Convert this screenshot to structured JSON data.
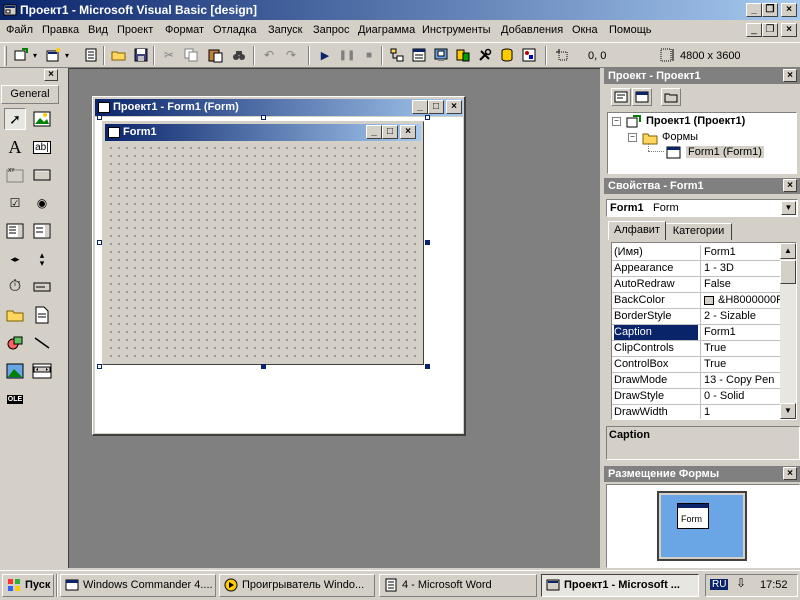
{
  "title": "Проект1 - Microsoft Visual Basic [design]",
  "menu": [
    "Файл",
    "Правка",
    "Вид",
    "Проект",
    "Формат",
    "Отладка",
    "Запуск",
    "Запрос",
    "Диаграмма",
    "Инструменты",
    "Добавления",
    "Окна",
    "Помощь"
  ],
  "toolbar": {
    "coords": "0, 0",
    "size": "4800 x 3600"
  },
  "toolbox": {
    "tab_label": "General",
    "text_tool": "A",
    "textbox_tool": "ab|",
    "ole_tool": "OLE"
  },
  "designer": {
    "title": "Проект1 - Form1 (Form)",
    "form_caption": "Form1"
  },
  "project_panel": {
    "title": "Проект - Проект1",
    "root": "Проект1 (Проект1)",
    "folder": "Формы",
    "item": "Form1 (Form1)"
  },
  "properties_panel": {
    "title": "Свойства - Form1",
    "object_name": "Form1",
    "object_type": "Form",
    "tab_alpha": "Алфавит",
    "tab_category": "Категории",
    "rows": [
      {
        "name": "(Имя)",
        "value": "Form1"
      },
      {
        "name": "Appearance",
        "value": "1 - 3D"
      },
      {
        "name": "AutoRedraw",
        "value": "False"
      },
      {
        "name": "BackColor",
        "value": "&H8000000F"
      },
      {
        "name": "BorderStyle",
        "value": "2 - Sizable"
      },
      {
        "name": "Caption",
        "value": "Form1"
      },
      {
        "name": "ClipControls",
        "value": "True"
      },
      {
        "name": "ControlBox",
        "value": "True"
      },
      {
        "name": "DrawMode",
        "value": "13 - Copy Pen"
      },
      {
        "name": "DrawStyle",
        "value": "0 - Solid"
      },
      {
        "name": "DrawWidth",
        "value": "1"
      }
    ],
    "selected_index": 5,
    "description_title": "Caption"
  },
  "layout_panel": {
    "title": "Размещение Формы",
    "form_label": "Form"
  },
  "taskbar": {
    "start": "Пуск",
    "tasks": [
      "Windows Commander 4....",
      "Проигрыватель Windo...",
      "4 - Microsoft Word",
      "Проект1 - Microsoft ..."
    ],
    "lang": "RU",
    "clock": "17:52"
  },
  "colors": {
    "title_active": "#0a246a",
    "title_gradient_end": "#a6caf0",
    "workspace": "#808080",
    "face": "#d4d0c8",
    "selection": "#0a246a",
    "monitor_screen": "#6aa6e6"
  }
}
